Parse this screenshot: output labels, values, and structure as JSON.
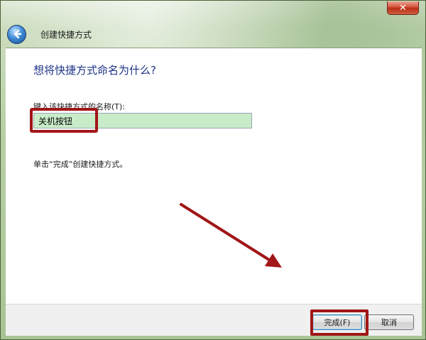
{
  "window": {
    "title": "创建快捷方式",
    "close_icon": "close-icon",
    "back_icon": "back-arrow-icon"
  },
  "main": {
    "heading": "想将快捷方式命名为什么?",
    "name_label": "键入该快捷方式的名称(T):",
    "name_value": "关机按钮",
    "hint": "单击“完成”创建快捷方式。"
  },
  "footer": {
    "finish_label": "完成(F)",
    "cancel_label": "取消"
  },
  "colors": {
    "heading": "#1e3287",
    "highlight": "#a11616",
    "input_bg": "#c9ecc8"
  }
}
